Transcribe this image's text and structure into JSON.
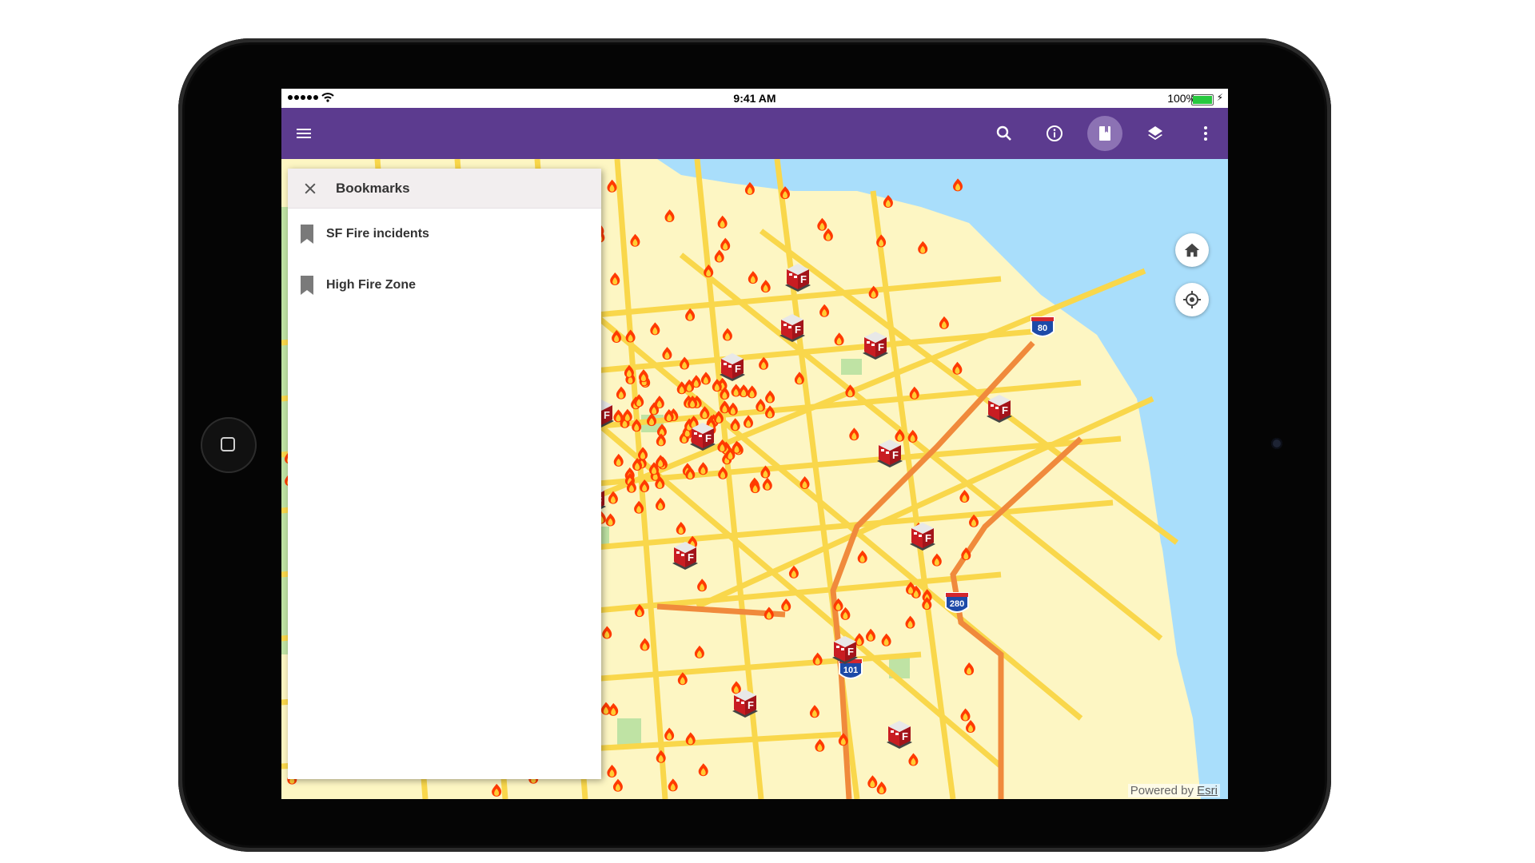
{
  "status_bar": {
    "time": "9:41 AM",
    "battery": "100%"
  },
  "toolbar": {
    "menu_icon": "menu-icon",
    "actions": [
      "search-icon",
      "info-icon",
      "bookmark-icon",
      "layers-icon",
      "more-vert-icon"
    ],
    "active_action": "bookmark-icon",
    "colors": {
      "toolbar": "#5c3b8f",
      "active": "#8c72b4"
    }
  },
  "bookmarks_panel": {
    "title": "Bookmarks",
    "items": [
      {
        "label": "SF Fire incidents",
        "icon": "bookmark-icon"
      },
      {
        "label": "High Fire Zone",
        "icon": "bookmark-icon"
      }
    ]
  },
  "map": {
    "controls": [
      "home-icon",
      "locate-icon"
    ],
    "shields": [
      "80",
      "280",
      "101"
    ],
    "attribution": {
      "prefix": "Powered by",
      "link": "Esri"
    },
    "colors": {
      "land": "#fdf6c3",
      "water": "#a9defb",
      "park": "#bfe3a4",
      "street": "#f9d74b",
      "highway": "#f08a3c",
      "fire": "#ff3a00"
    }
  }
}
